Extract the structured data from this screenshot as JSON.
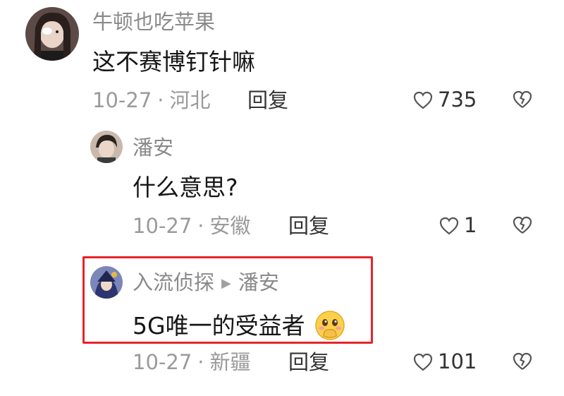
{
  "comments": [
    {
      "username": "牛顿也吃苹果",
      "text": "这不赛博钉针嘛",
      "date": "10-27",
      "location": "河北",
      "reply_label": "回复",
      "likes": "735"
    },
    {
      "username": "潘安",
      "text": "什么意思?",
      "date": "10-27",
      "location": "安徽",
      "reply_label": "回复",
      "likes": "1"
    },
    {
      "username": "入流侦探",
      "reply_to": "潘安",
      "text": "5G唯一的受益者",
      "emoji": "🤭",
      "date": "10-27",
      "location": "新疆",
      "reply_label": "回复",
      "likes": "101"
    }
  ],
  "meta_separator": "·",
  "colors": {
    "highlight_border": "#e8242a",
    "username": "#8a8a8a",
    "meta": "#9a9a9a"
  }
}
